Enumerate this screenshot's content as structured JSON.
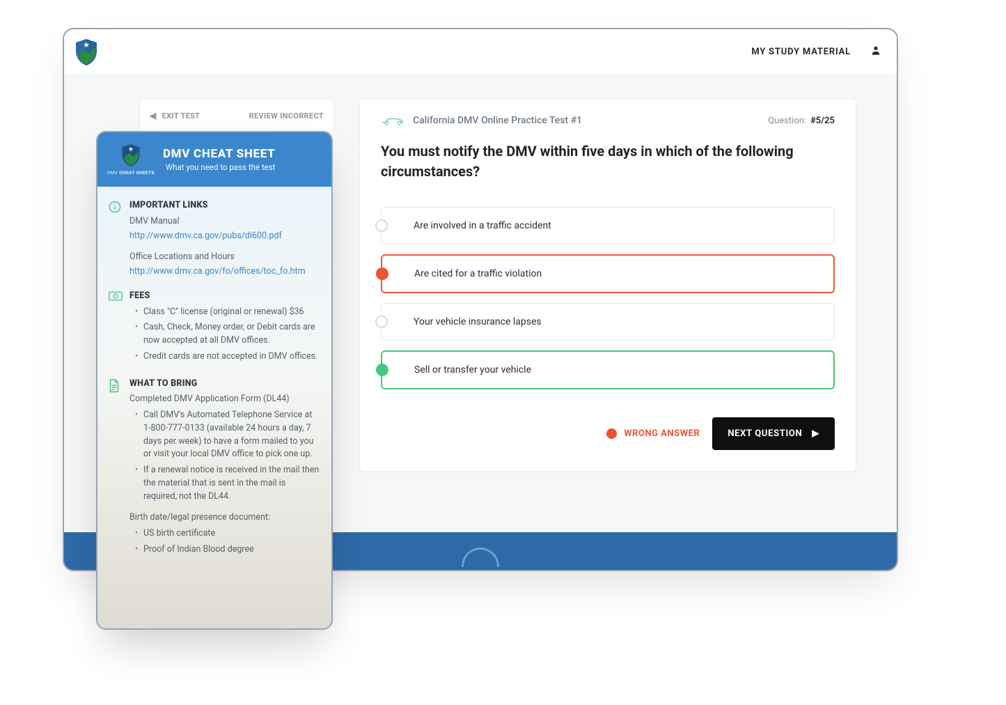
{
  "topbar": {
    "my_study": "MY STUDY MATERIAL"
  },
  "toolbar": {
    "exit": "EXIT TEST",
    "review": "REVIEW INCORRECT"
  },
  "card": {
    "title": "California DMV Online Practice Test #1",
    "q_label": "Question:",
    "q_count": "#5/25",
    "question": "You must notify the DMV within five days in which of the following circumstances?",
    "answers": [
      {
        "text": "Are involved in a traffic accident",
        "state": ""
      },
      {
        "text": "Are cited for a traffic violation",
        "state": "wrong"
      },
      {
        "text": "Your vehicle insurance lapses",
        "state": ""
      },
      {
        "text": "Sell or transfer your vehicle",
        "state": "correct"
      }
    ],
    "wrong_label": "WRONG ANSWER",
    "next_label": "NEXT QUESTION"
  },
  "sheet": {
    "title": "DMV CHEAT SHEET",
    "subtitle": "What you need to pass the test",
    "brand_sub_a": "DMV",
    "brand_sub_b": "CHEAT SHEETS",
    "links": {
      "heading": "IMPORTANT LINKS",
      "manual_label": "DMV Manual",
      "manual_url": "http://www.dmv.ca.gov/pubs/dl600.pdf",
      "office_label": "Office Locations and Hours",
      "office_url": "http://www.dmv.ca.gov/fo/offices/toc_fo.htm"
    },
    "fees": {
      "heading": "FEES",
      "items": [
        "Class \"C\" license (original or renewal) $36",
        "Cash, Check, Money order, or Debit cards are now accepted at all DMV offices.",
        "Credit cards are not accepted in DMV offices."
      ]
    },
    "bring": {
      "heading": "WHAT TO BRING",
      "intro": "Completed DMV Application Form (DL44)",
      "items": [
        "Call DMV's Automated Telephone Service at 1-800-777-0133 (available 24 hours a day, 7 days per week) to have a form mailed to you or visit your local DMV office to pick one up.",
        "If a renewal notice is received in the mail then the material that is sent in the mail is required, not the DL44."
      ],
      "birth_intro": "Birth date/legal presence document:",
      "birth_items": [
        "US birth certificate",
        "Proof of Indian Blood degree"
      ]
    }
  }
}
